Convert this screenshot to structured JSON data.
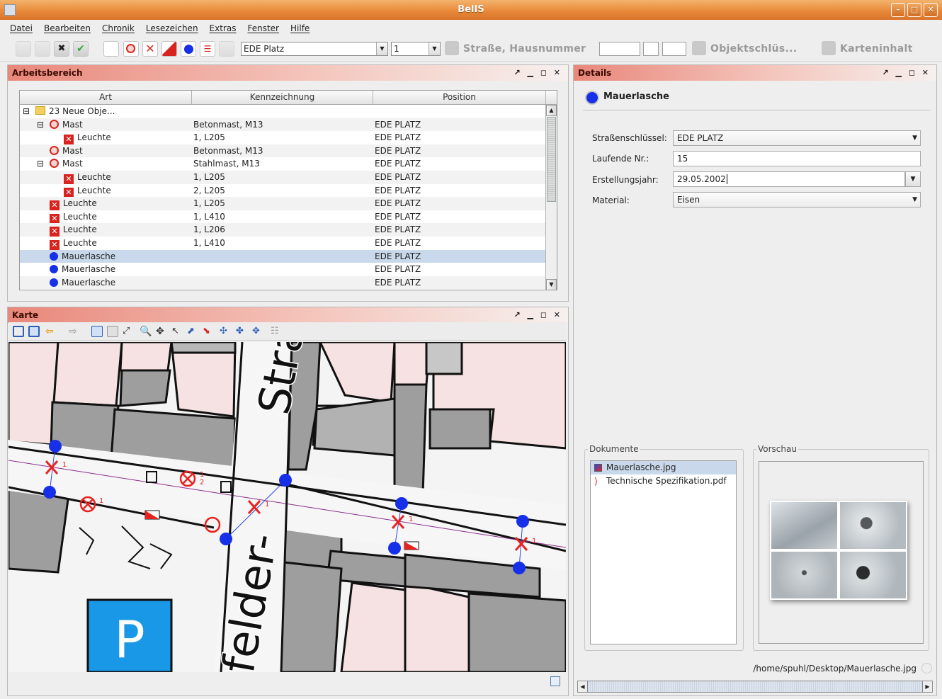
{
  "window": {
    "title": "BelIS",
    "controls": [
      "–",
      "□",
      "✕"
    ]
  },
  "menu": [
    "Datei",
    "Bearbeiten",
    "Chronik",
    "Lesezeichen",
    "Extras",
    "Fenster",
    "Hilfe"
  ],
  "toolbar": {
    "street_combo": "EDE Platz",
    "number_combo": "1",
    "street_search_label": "Straße, Hausnummer",
    "object_key_label": "Objektschlüs...",
    "map_content_label": "Karteninhalt"
  },
  "workarea": {
    "title": "Arbeitsbereich",
    "controls": "↗ ▁ ◻ ✕",
    "columns": [
      "Art",
      "Kennzeichnung",
      "Position"
    ],
    "rows": [
      {
        "level": 0,
        "expander": "⊟",
        "icon": "folder",
        "art": "23 Neue Obje...",
        "kenn": "",
        "pos": ""
      },
      {
        "level": 1,
        "expander": "⊟",
        "icon": "ring",
        "art": "Mast",
        "kenn": "Betonmast, M13",
        "pos": "EDE PLATZ"
      },
      {
        "level": 2,
        "expander": "",
        "icon": "x",
        "art": "Leuchte",
        "kenn": "1, L205",
        "pos": "EDE PLATZ"
      },
      {
        "level": 1,
        "expander": "",
        "icon": "ring",
        "art": "Mast",
        "kenn": "Betonmast, M13",
        "pos": "EDE PLATZ"
      },
      {
        "level": 1,
        "expander": "⊟",
        "icon": "ring",
        "art": "Mast",
        "kenn": "Stahlmast, M13",
        "pos": "EDE PLATZ"
      },
      {
        "level": 2,
        "expander": "",
        "icon": "x",
        "art": "Leuchte",
        "kenn": "1, L205",
        "pos": "EDE PLATZ"
      },
      {
        "level": 2,
        "expander": "",
        "icon": "x",
        "art": "Leuchte",
        "kenn": "2, L205",
        "pos": "EDE PLATZ"
      },
      {
        "level": 1,
        "expander": "",
        "icon": "x",
        "art": "Leuchte",
        "kenn": "1, L205",
        "pos": "EDE PLATZ"
      },
      {
        "level": 1,
        "expander": "",
        "icon": "x",
        "art": "Leuchte",
        "kenn": "1, L410",
        "pos": "EDE PLATZ"
      },
      {
        "level": 1,
        "expander": "",
        "icon": "x",
        "art": "Leuchte",
        "kenn": "1, L206",
        "pos": "EDE PLATZ"
      },
      {
        "level": 1,
        "expander": "",
        "icon": "x",
        "art": "Leuchte",
        "kenn": "1, L410",
        "pos": "EDE PLATZ"
      },
      {
        "level": 1,
        "expander": "",
        "icon": "dot",
        "art": "Mauerlasche",
        "kenn": "",
        "pos": "EDE PLATZ",
        "selected": true
      },
      {
        "level": 1,
        "expander": "",
        "icon": "dot",
        "art": "Mauerlasche",
        "kenn": "",
        "pos": "EDE PLATZ"
      },
      {
        "level": 1,
        "expander": "",
        "icon": "dot",
        "art": "Mauerlasche",
        "kenn": "",
        "pos": "EDE PLATZ"
      }
    ]
  },
  "map": {
    "title": "Karte",
    "controls": "↗ ▁ ◻ ✕",
    "street_text_1": "Stra",
    "street_text_2": "felder-",
    "parking_label": "P",
    "marker_labels": [
      "1",
      "1",
      "1",
      "1",
      "1",
      "1",
      "2"
    ]
  },
  "details": {
    "title": "Details",
    "controls": "↗ ▁ ◻ ✕",
    "heading": "Mauerlasche",
    "fields": {
      "strassenschluessel_label": "Straßenschlüssel:",
      "strassenschluessel_value": "EDE PLATZ",
      "laufende_nr_label": "Laufende Nr.:",
      "laufende_nr_value": "15",
      "erstellungsjahr_label": "Erstellungsjahr:",
      "erstellungsjahr_value": "29.05.2002",
      "material_label": "Material:",
      "material_value": "Eisen"
    },
    "documents_title": "Dokumente",
    "documents": [
      {
        "name": "Mauerlasche.jpg",
        "type": "image",
        "selected": true
      },
      {
        "name": "Technische Spezifikation.pdf",
        "type": "pdf",
        "selected": false
      }
    ],
    "preview_title": "Vorschau",
    "file_path": "/home/spuhl/Desktop/Mauerlasche.jpg"
  }
}
